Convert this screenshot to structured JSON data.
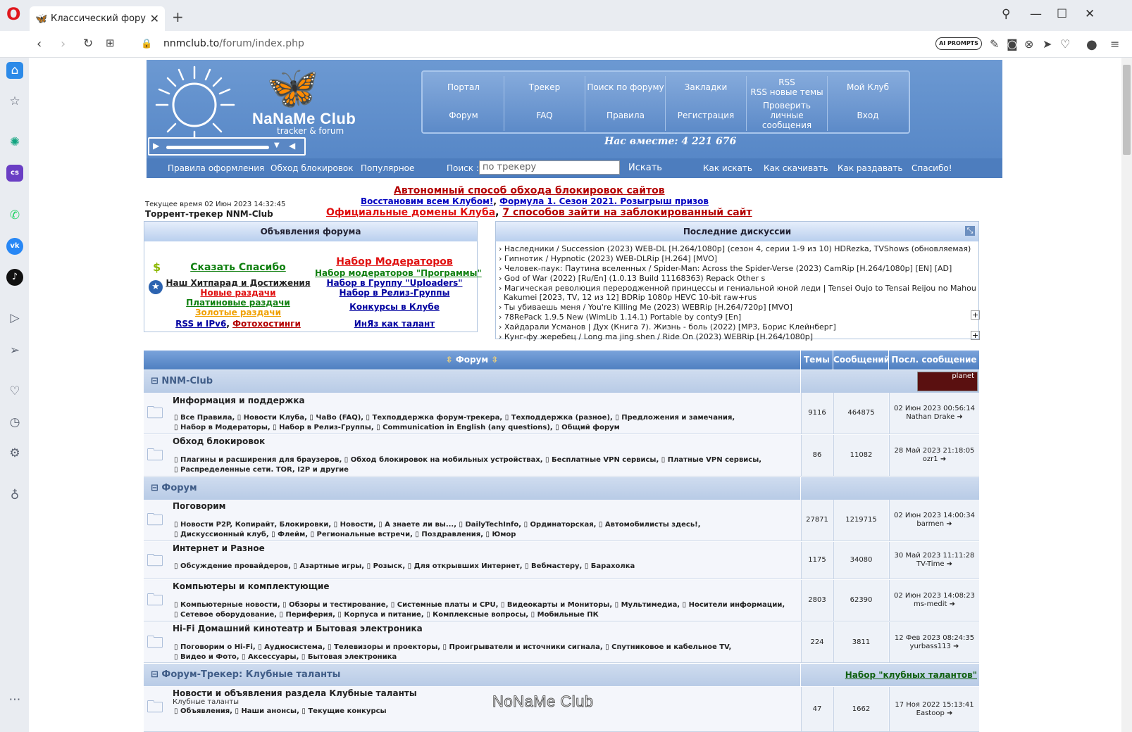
{
  "browser": {
    "tab_title": "Классический форум-тре",
    "url_host": "nnmclub.to",
    "url_path": "/forum/index.php",
    "ai_prompts": "AI PROMPTS"
  },
  "header": {
    "logo_name": "NaNaMe Club",
    "logo_sub": "tracker & forum",
    "nav": [
      {
        "label": "Портал"
      },
      {
        "label": "Трекер"
      },
      {
        "label": "Поиск по форуму"
      },
      {
        "label": "Закладки"
      },
      {
        "label": "RSS\nRSS новые темы"
      },
      {
        "label": "Мой Клуб"
      },
      {
        "label": "Форум"
      },
      {
        "label": "FAQ"
      },
      {
        "label": "Правила"
      },
      {
        "label": "Регистрация"
      },
      {
        "label": "Проверить личные сообщения"
      },
      {
        "label": "Вход"
      }
    ],
    "together": "Нас вместе: 4 221 676",
    "subnav": {
      "rules": "Правила оформления",
      "bypass": "Обход блокировок",
      "popular": "Популярное",
      "search_label": "Поиск :",
      "search_placeholder": "по трекеру",
      "search_button": "Искать",
      "how_search": "Как искать",
      "how_download": "Как скачивать",
      "how_seed": "Как раздавать",
      "thanks": "Спасибо!"
    }
  },
  "info": {
    "current_time": "Текущее время 02 Июн 2023 14:32:45",
    "tracker": "Торрент-трекер NNM-Club",
    "ann1": "Автономный способ обхода блокировок сайтов",
    "ann2a": "Восстановим всем Клубом!",
    "ann2sep": ",",
    "ann2b": "Формула 1. Сезон 2021. Розыгрыш призов",
    "ann3a": "Официальные домены Клуба",
    "ann3sep": ",",
    "ann3b": "7 способов зайти на заблокированный сайт"
  },
  "announcements": {
    "title": "Объявления форума",
    "say_thanks": "Сказать Спасибо",
    "hitparade": "Наш Хитпарад и Достижения",
    "new_rel": "Новые раздачи",
    "paid_rel": "Платиновые раздачи",
    "gold_rel": "Золотые раздачи",
    "rss": "RSS и IPv6",
    "rss_sep": ",",
    "photo": "Фотохостинги",
    "mods": "Набор Модераторов",
    "mods_prog": "Набор модераторов \"Программы\"",
    "uploaders": "Набор в Группу \"Uploaders\"",
    "release_grp": "Набор в Релиз-Группы",
    "contests": "Конкурсы в Клубе",
    "inyaz": "ИнЯз как талант"
  },
  "discussions": {
    "title": "Последние дискуссии",
    "items": [
      "› Наследники / Succession (2023) WEB-DL [H.264/1080p] (сезон 4, серии 1-9 из 10) HDRezka, TVShows (обновляемая)",
      "› Гипнотик / Hypnotic (2023) WEB-DLRip [H.264] [MVO]",
      "› Человек-паук: Паутина вселенных / Spider-Man: Across the Spider-Verse (2023) CamRip [H.264/1080p] [EN] [AD]",
      "› God of War (2022) [Ru/En] (1.0.13 Build 11168363) Repack Other s",
      "› Магическая революция переродженной принцессы и гениальной юной леди | Tensei Oujo to Tensai Reijou no Mahou",
      "  Kakumei [2023, TV, 12 из 12] BDRip 1080p HEVC 10-bit raw+rus",
      "› Ты убиваешь меня / You're Killing Me (2023) WEBRip [H.264/720p] [MVO]",
      "› 78RePack 1.9.5 New (WimLib 1.14.1) Portable by conty9 [En]",
      "› Хайдарали Усманов | Дух (Книга 7). Жизнь - боль (2022) [MP3, Борис Клейнберг]",
      "› Кунг-фу жеребец / Long ma jing shen / Ride On (2023) WEBRip [H.264/1080p]"
    ]
  },
  "table": {
    "col_forum": "Форум",
    "col_topics": "Темы",
    "col_posts": "Сообщений",
    "col_last": "Посл. сообщение",
    "cat1": "NNM-Club",
    "cat1_badge": "planet",
    "cat2": "Форум",
    "cat3": "Форум-Трекер: Клубные таланты",
    "cat3_link": "Набор \"клубных талантов\"",
    "rows": [
      {
        "title": "Информация и поддержка",
        "sub1": "▯ Все Правила, ▯ Новости Клуба, ▯ ЧаВо (FAQ), ▯ Техподдержка форум-трекера, ▯ Техподдержка (разное), ▯ Предложения и замечания,",
        "sub2": "▯ Набор в Модераторы, ▯ Набор в Релиз-Группы, ▯ Communication in English (any questions), ▯ Общий форум",
        "topics": "9116",
        "posts": "464875",
        "last_date": "02 Июн 2023 00:56:14",
        "last_user": "Nathan Drake ➜"
      },
      {
        "title": "Обход блокировок",
        "sub1": "▯ Плагины и расширения для браузеров, ▯ Обход блокировок на мобильных устройствах, ▯ Бесплатные VPN сервисы, ▯ Платные VPN сервисы,",
        "sub2": "▯ Распределенные сети. TOR, I2P и другие",
        "topics": "86",
        "posts": "11082",
        "last_date": "28 Май 2023 21:18:05",
        "last_user": "ozr1 ➜"
      },
      {
        "title": "Поговорим",
        "sub1": "▯ Новости P2P, Копирайт, Блокировки, ▯ Новости, ▯ А знаете ли вы..., ▯ DailyTechInfo, ▯ Ординаторская, ▯ Автомобилисты здесь!,",
        "sub2": "▯ Дискуссионный клуб, ▯ Флейм, ▯ Региональные встречи, ▯ Поздравления, ▯ Юмор",
        "topics": "27871",
        "posts": "1219715",
        "last_date": "02 Июн 2023 14:00:34",
        "last_user": "barmen ➜"
      },
      {
        "title": "Интернет и Разное",
        "sub1": "▯ Обсуждение провайдеров, ▯ Азартные игры, ▯ Розыск, ▯ Для открывших Интернет, ▯ Вебмастеру, ▯ Барахолка",
        "sub2": "",
        "topics": "1175",
        "posts": "34080",
        "last_date": "30 Май 2023 11:11:28",
        "last_user": "TV-Time ➜"
      },
      {
        "title": "Компьютеры и комплектующие",
        "sub1": "▯ Компьютерные новости, ▯ Обзоры и тестирование, ▯ Системные платы и CPU, ▯ Видеокарты и Мониторы, ▯ Мультимедиа, ▯ Носители информации,",
        "sub2": "▯ Сетевое оборудование, ▯ Периферия, ▯ Корпуса и питание, ▯ Комплексные вопросы, ▯ Мобильные ПК",
        "topics": "2803",
        "posts": "62390",
        "last_date": "02 Июн 2023 14:08:23",
        "last_user": "ms-medit ➜"
      },
      {
        "title": "Hi-Fi Домашний кинотеатр и Бытовая электроника",
        "sub1": "▯ Поговорим о Hi-Fi, ▯ Аудиосистема, ▯ Телевизоры и проекторы, ▯ Проигрыватели и источники сигнала, ▯ Спутниковое и кабельное TV,",
        "sub2": "▯ Видео и Фото, ▯ Аксессуары, ▯ Бытовая электроника",
        "topics": "224",
        "posts": "3811",
        "last_date": "12 Фев 2023 08:24:35",
        "last_user": "yurbass113 ➜"
      },
      {
        "title": "Новости и объявления раздела Клубные таланты",
        "note": "Клубные таланты",
        "sub1": "▯ Объявления, ▯ Наши анонсы, ▯ Текущие конкурсы",
        "sub2": "",
        "topics": "47",
        "posts": "1662",
        "last_date": "17 Ноя 2022 15:13:41",
        "last_user": "Eastoop ➜"
      }
    ]
  },
  "watermark": "NoNaMe Club"
}
